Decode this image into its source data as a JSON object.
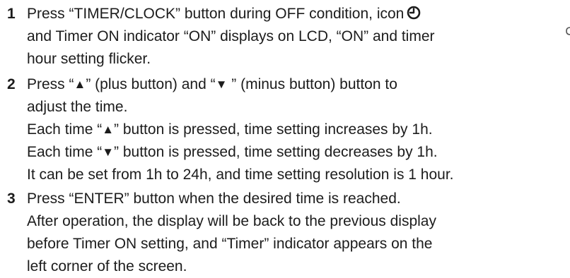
{
  "steps": [
    {
      "number": "1",
      "lines": [
        "Press “TIMER/CLOCK” button during OFF condition, icon",
        "and Timer ON indicator “ON” displays on LCD, “ON” and timer",
        "hour setting flicker."
      ],
      "icon": "clock-icon"
    },
    {
      "number": "2",
      "line1_a": "Press “",
      "plus_symbol": "▲",
      "line1_b": "” (plus button) and “",
      "minus_symbol": "▼",
      "line1_c": " ” (minus button) button to",
      "line2": "adjust the time.",
      "line3_a": "Each time “",
      "line3_b": "” button is pressed, time setting increases by 1h.",
      "line4_a": "Each time “",
      "line4_b": "” button is pressed, time setting decreases by 1h.",
      "line5": "It can be set from 1h to 24h, and time setting resolution is 1 hour."
    },
    {
      "number": "3",
      "lines": [
        "Press “ENTER” button when the desired time is reached.",
        "After operation, the display will be back to the previous display",
        "before Timer ON setting, and “Timer” indicator appears on the",
        "left corner of the screen."
      ]
    }
  ],
  "colors": {
    "text": "#1c1c1c",
    "background": "#ffffff"
  }
}
